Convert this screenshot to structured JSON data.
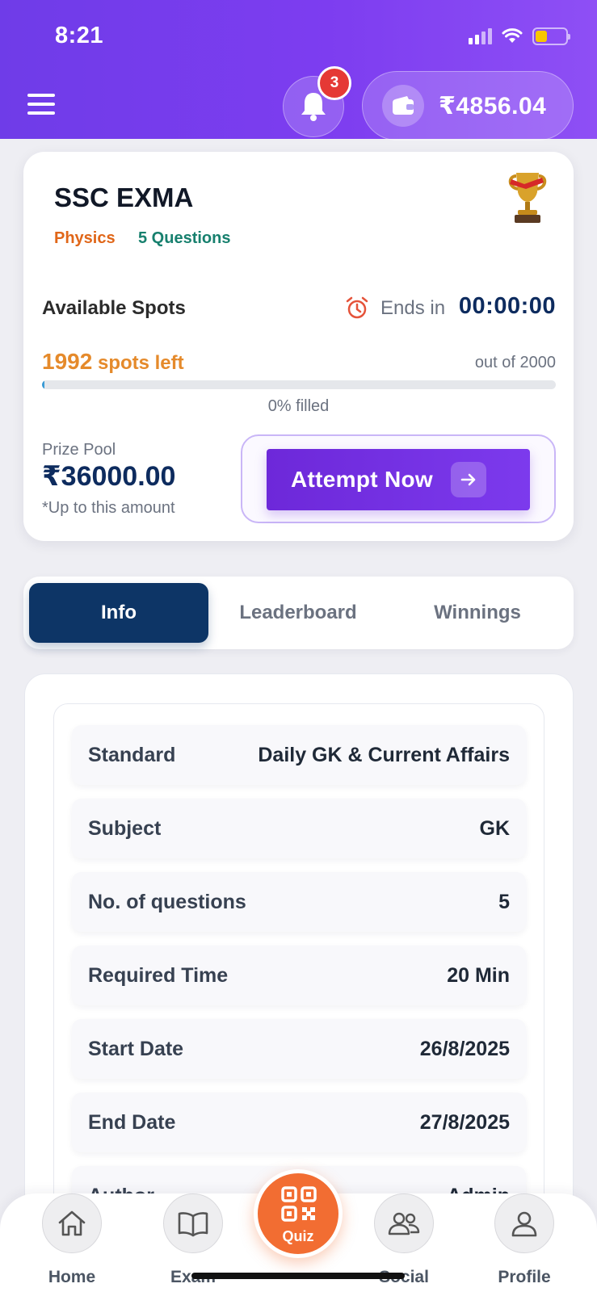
{
  "status_bar": {
    "time": "8:21"
  },
  "header": {
    "notification_count": "3",
    "wallet_balance": "₹4856.04"
  },
  "quiz": {
    "title": "SSC EXMA",
    "subject": "Physics",
    "question_count": "5 Questions",
    "spots_label": "Available Spots",
    "ends_label": "Ends in",
    "ends_time": "00:00:00",
    "spots_left_number": "1992",
    "spots_left_suffix": " spots left",
    "spots_total": "out of 2000",
    "filled_fraction": 0,
    "filled_text": "0% filled",
    "prize_label": "Prize Pool",
    "prize_amount": "₹36000.00",
    "prize_note": "*Up to this amount",
    "attempt_label": "Attempt Now"
  },
  "tabs": [
    {
      "label": "Info",
      "active": true
    },
    {
      "label": "Leaderboard",
      "active": false
    },
    {
      "label": "Winnings",
      "active": false
    }
  ],
  "info_rows": [
    {
      "label": "Standard",
      "value": "Daily GK & Current Affairs"
    },
    {
      "label": "Subject",
      "value": "GK"
    },
    {
      "label": "No. of questions",
      "value": "5"
    },
    {
      "label": "Required Time",
      "value": "20 Min"
    },
    {
      "label": "Start Date",
      "value": "26/8/2025"
    },
    {
      "label": "End Date",
      "value": "27/8/2025"
    },
    {
      "label": "Author",
      "value": "Admin"
    }
  ],
  "bottom_nav": {
    "home": "Home",
    "exam": "Exam",
    "quiz": "Quiz",
    "social": "Social",
    "profile": "Profile"
  },
  "colors": {
    "header_gradient_start": "#6f3ce8",
    "header_gradient_end": "#8e4ff5",
    "primary_navy": "#0d2b5e",
    "accent_orange": "#f26d32",
    "subject_orange": "#e06618",
    "question_teal": "#17806e",
    "spots_orange": "#e58a2b",
    "attempt_purple": "#6d28d9",
    "badge_red": "#e53935"
  },
  "icons": [
    "menu-icon",
    "bell-icon",
    "wallet-icon",
    "trophy-icon",
    "alarm-clock-icon",
    "arrow-right-icon",
    "home-icon",
    "book-icon",
    "qr-code-icon",
    "people-icon",
    "person-icon"
  ]
}
